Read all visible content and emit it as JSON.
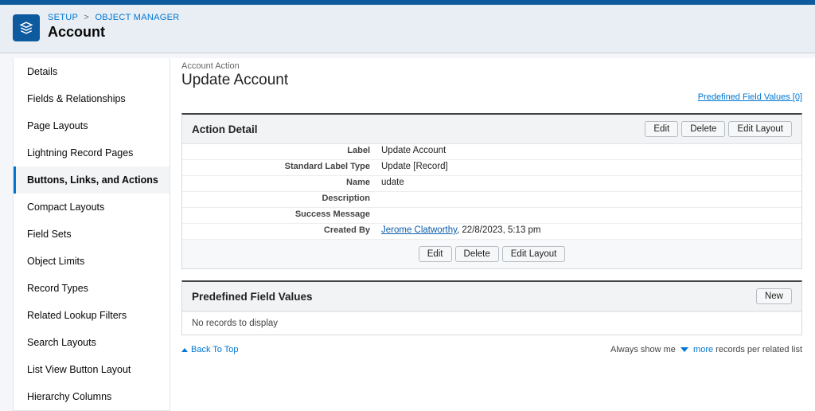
{
  "breadcrumb": {
    "setup": "SETUP",
    "object_manager": "OBJECT MANAGER"
  },
  "page_title": "Account",
  "sidebar": {
    "items": [
      {
        "label": "Details"
      },
      {
        "label": "Fields & Relationships"
      },
      {
        "label": "Page Layouts"
      },
      {
        "label": "Lightning Record Pages"
      },
      {
        "label": "Buttons, Links, and Actions"
      },
      {
        "label": "Compact Layouts"
      },
      {
        "label": "Field Sets"
      },
      {
        "label": "Object Limits"
      },
      {
        "label": "Record Types"
      },
      {
        "label": "Related Lookup Filters"
      },
      {
        "label": "Search Layouts"
      },
      {
        "label": "List View Button Layout"
      },
      {
        "label": "Hierarchy Columns"
      }
    ],
    "active_index": 4
  },
  "overline": "Account Action",
  "heading": "Update Account",
  "quick_link": {
    "text": "Predefined Field Values",
    "count": "[0]"
  },
  "action_detail": {
    "title": "Action Detail",
    "buttons": {
      "edit": "Edit",
      "delete": "Delete",
      "edit_layout": "Edit Layout"
    },
    "rows": {
      "label_label": "Label",
      "label_value": "Update Account",
      "std_label_type_label": "Standard Label Type",
      "std_label_type_value": "Update [Record]",
      "name_label": "Name",
      "name_value": "udate",
      "description_label": "Description",
      "description_value": "",
      "success_label": "Success Message",
      "success_value": "",
      "created_by_label": "Created By",
      "created_by_user": "Jerome Clatworthy",
      "created_by_meta": ", 22/8/2023, 5:13 pm"
    }
  },
  "predefined": {
    "title": "Predefined Field Values",
    "new_button": "New",
    "empty": "No records to display"
  },
  "footer": {
    "back_to_top": "Back To Top",
    "always_show": "Always show me",
    "more": "more",
    "records_tail": "records per related list"
  }
}
